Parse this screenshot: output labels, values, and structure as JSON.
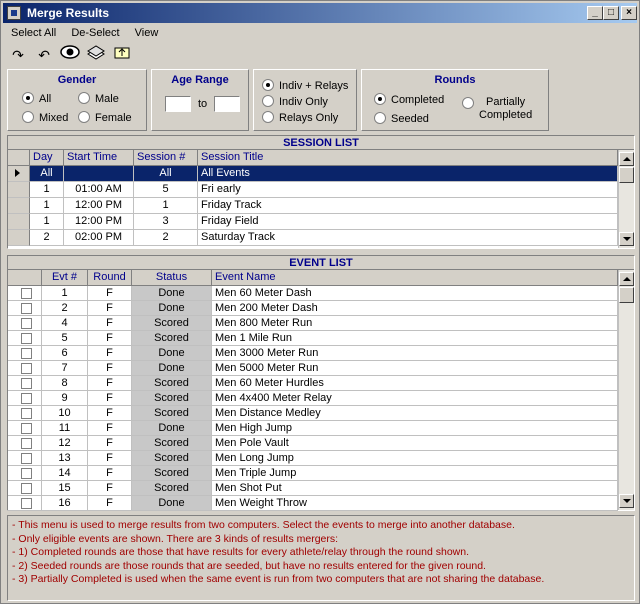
{
  "window": {
    "title": "Merge Results"
  },
  "menu": [
    "Select All",
    "De-Select",
    "View"
  ],
  "toolbar_icons": [
    "redo-icon",
    "undo-icon",
    "eye-icon",
    "books-icon",
    "folder-up-icon"
  ],
  "gender": {
    "title": "Gender",
    "options": [
      {
        "label": "All",
        "selected": true
      },
      {
        "label": "Male",
        "selected": false
      },
      {
        "label": "Mixed",
        "selected": false
      },
      {
        "label": "Female",
        "selected": false
      }
    ]
  },
  "age_range": {
    "title": "Age Range",
    "to_label": "to",
    "from_value": "",
    "to_value": ""
  },
  "relay": {
    "options": [
      {
        "label": "Indiv + Relays",
        "selected": true
      },
      {
        "label": "Indiv Only",
        "selected": false
      },
      {
        "label": "Relays Only",
        "selected": false
      }
    ]
  },
  "rounds": {
    "title": "Rounds",
    "options": [
      {
        "label": "Completed",
        "selected": true
      },
      {
        "label": "Seeded",
        "selected": false
      },
      {
        "label": "Partially",
        "label2": "Completed",
        "selected": false
      }
    ]
  },
  "session_list": {
    "caption": "SESSION LIST",
    "columns": [
      "Day",
      "Start Time",
      "Session #",
      "Session Title"
    ],
    "rows": [
      {
        "day": "All",
        "start": "",
        "session": "All",
        "title": "All Events",
        "selected": true
      },
      {
        "day": "1",
        "start": "01:00 AM",
        "session": "5",
        "title": "Fri early",
        "selected": false
      },
      {
        "day": "1",
        "start": "12:00 PM",
        "session": "1",
        "title": "Friday Track",
        "selected": false
      },
      {
        "day": "1",
        "start": "12:00 PM",
        "session": "3",
        "title": "Friday Field",
        "selected": false
      },
      {
        "day": "2",
        "start": "02:00 PM",
        "session": "2",
        "title": "Saturday Track",
        "selected": false
      }
    ]
  },
  "event_list": {
    "caption": "EVENT LIST",
    "columns": [
      "Evt #",
      "Round",
      "Status",
      "Event Name"
    ],
    "rows": [
      {
        "evt": "1",
        "round": "F",
        "status": "Done",
        "name": "Men 60 Meter Dash"
      },
      {
        "evt": "2",
        "round": "F",
        "status": "Done",
        "name": "Men 200 Meter Dash"
      },
      {
        "evt": "4",
        "round": "F",
        "status": "Scored",
        "name": "Men 800 Meter Run"
      },
      {
        "evt": "5",
        "round": "F",
        "status": "Scored",
        "name": "Men 1 Mile Run"
      },
      {
        "evt": "6",
        "round": "F",
        "status": "Done",
        "name": "Men 3000 Meter Run"
      },
      {
        "evt": "7",
        "round": "F",
        "status": "Done",
        "name": "Men 5000 Meter Run"
      },
      {
        "evt": "8",
        "round": "F",
        "status": "Scored",
        "name": "Men 60 Meter Hurdles"
      },
      {
        "evt": "9",
        "round": "F",
        "status": "Scored",
        "name": "Men 4x400 Meter Relay"
      },
      {
        "evt": "10",
        "round": "F",
        "status": "Scored",
        "name": "Men Distance Medley"
      },
      {
        "evt": "11",
        "round": "F",
        "status": "Done",
        "name": "Men High Jump"
      },
      {
        "evt": "12",
        "round": "F",
        "status": "Scored",
        "name": "Men Pole Vault"
      },
      {
        "evt": "13",
        "round": "F",
        "status": "Scored",
        "name": "Men Long Jump"
      },
      {
        "evt": "14",
        "round": "F",
        "status": "Scored",
        "name": "Men Triple Jump"
      },
      {
        "evt": "15",
        "round": "F",
        "status": "Scored",
        "name": "Men Shot Put"
      },
      {
        "evt": "16",
        "round": "F",
        "status": "Done",
        "name": "Men Weight Throw"
      }
    ]
  },
  "help_lines": [
    "- This menu is used to merge results from two computers.  Select the events to merge into another database.",
    "- Only eligible events are shown. There are 3 kinds of results mergers:",
    "- 1) Completed rounds are those that have results for every athlete/relay through the round shown.",
    "- 2) Seeded rounds are those rounds that are seeded, but have no results entered for the given round.",
    "- 3) Partially Completed is used when the same event is run from two computers that are not sharing the database."
  ]
}
